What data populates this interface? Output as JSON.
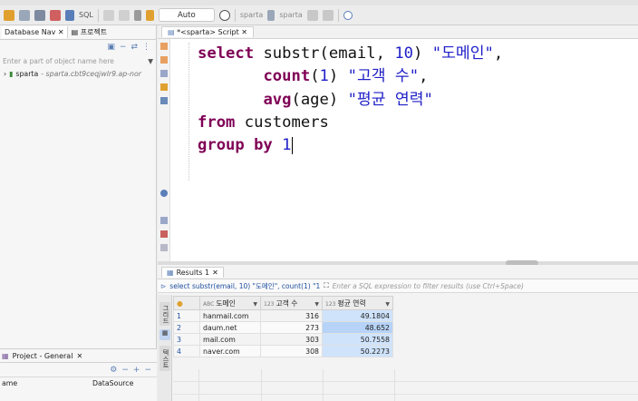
{
  "toolbar": {
    "sql_label": "SQL",
    "mode": "Auto",
    "connection_label_1": "sparta",
    "connection_label_2": "sparta"
  },
  "left_panel": {
    "tabs": [
      "Database Nav",
      "프로젝트"
    ],
    "filter_placeholder": "Enter a part of object name here",
    "tree": [
      {
        "name": "sparta",
        "detail": "- sparta.cbt9ceqjwlr9.ap-nor"
      }
    ]
  },
  "editor": {
    "tab_label": "*<sparta> Script",
    "lines": [
      {
        "indent": "",
        "parts": [
          {
            "t": "select",
            "c": "kw"
          },
          {
            "t": " substr(email, "
          },
          {
            "t": "10",
            "c": "num"
          },
          {
            "t": ") "
          },
          {
            "t": "\"도메인\"",
            "c": "str"
          },
          {
            "t": ","
          }
        ]
      },
      {
        "indent": "       ",
        "parts": [
          {
            "t": "count",
            "c": "kw"
          },
          {
            "t": "("
          },
          {
            "t": "1",
            "c": "num"
          },
          {
            "t": ") "
          },
          {
            "t": "\"고객 수\"",
            "c": "str"
          },
          {
            "t": ","
          }
        ]
      },
      {
        "indent": "       ",
        "parts": [
          {
            "t": "avg",
            "c": "kw"
          },
          {
            "t": "(age) "
          },
          {
            "t": "\"평균 연력\"",
            "c": "str"
          }
        ]
      },
      {
        "indent": "",
        "parts": [
          {
            "t": "from",
            "c": "kw"
          },
          {
            "t": " customers"
          }
        ]
      },
      {
        "indent": "",
        "parts": [
          {
            "t": "group by",
            "c": "kw"
          },
          {
            "t": " "
          },
          {
            "t": "1",
            "c": "num"
          }
        ]
      }
    ]
  },
  "results": {
    "tab_label": "Results 1",
    "query_preview": "select substr(email, 10) \"도메인\", count(1) \"1",
    "filter_placeholder": "Enter a SQL expression to filter results (use Ctrl+Space)",
    "side_labels": [
      "그리드",
      "텍스트"
    ],
    "columns": [
      {
        "type": "ABC",
        "name": "도메인"
      },
      {
        "type": "123",
        "name": "고객 수"
      },
      {
        "type": "123",
        "name": "평균 연력"
      }
    ],
    "rows": [
      {
        "n": "1",
        "domain": "hanmail.com",
        "count": "316",
        "avg": "49.1804"
      },
      {
        "n": "2",
        "domain": "daum.net",
        "count": "273",
        "avg": "48.652"
      },
      {
        "n": "3",
        "domain": "mail.com",
        "count": "303",
        "avg": "50.7558"
      },
      {
        "n": "4",
        "domain": "naver.com",
        "count": "308",
        "avg": "50.2273"
      }
    ]
  },
  "project": {
    "title": "Project - General",
    "col_name": "ame",
    "col_source": "DataSource"
  }
}
